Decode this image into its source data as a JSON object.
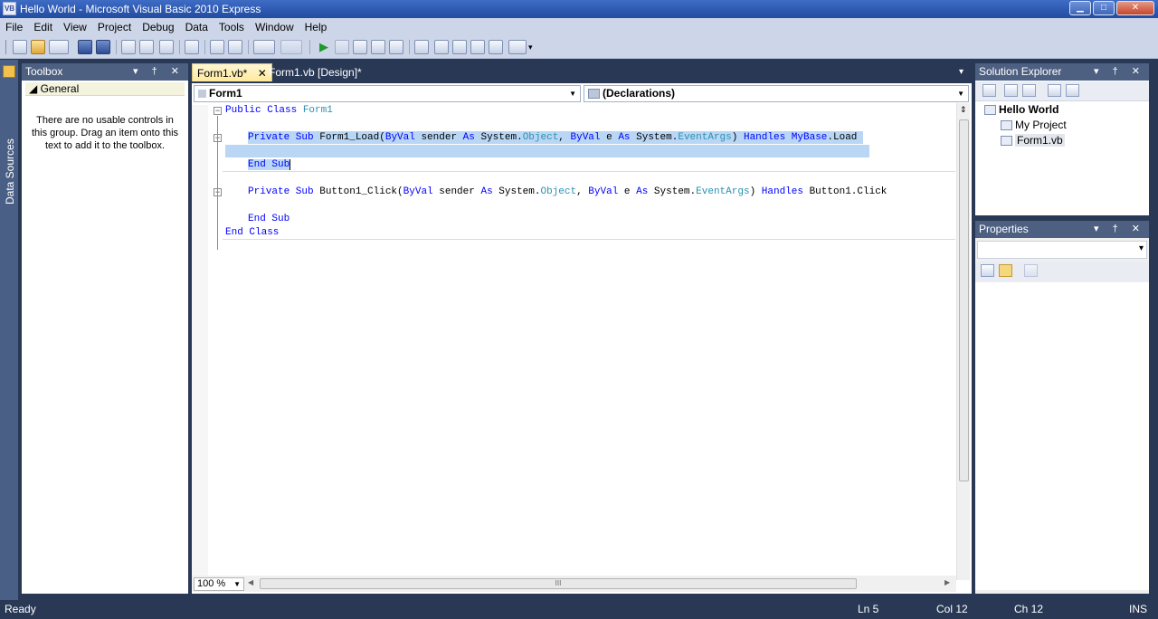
{
  "window": {
    "title": "Hello World - Microsoft Visual Basic 2010 Express",
    "icon_text": "VB",
    "controls": [
      "minimize-icon",
      "maximize-icon",
      "close-icon"
    ],
    "min_label": "▁",
    "max_label": "□",
    "close_label": "✕"
  },
  "menu": {
    "items": [
      "File",
      "Edit",
      "View",
      "Project",
      "Debug",
      "Data",
      "Tools",
      "Window",
      "Help"
    ]
  },
  "side_tab": {
    "label": "Data Sources"
  },
  "toolbox": {
    "title": "Toolbox",
    "buttons": "▾ † ✕",
    "group": "◢ General",
    "empty_text": "There are no usable controls in this group. Drag an item onto this text to add it to the toolbox."
  },
  "tabs": [
    {
      "label": "Form1.vb*",
      "close": "✕"
    },
    {
      "label": "Form1.vb [Design]*"
    }
  ],
  "tab_dropdown": "▾",
  "editor": {
    "class_combo": "Form1",
    "method_combo": "(Declarations)",
    "zoom": "100 %",
    "scroll_grip": "III"
  },
  "code": {
    "l1_kw": "Public Class ",
    "l1_ty": "Form1",
    "l2_kw1": "Private Sub ",
    "l2_name": "Form1_Load(",
    "l2_byval1": "ByVal",
    "l2_sender": " sender ",
    "l2_as1": "As",
    "l2_sys1": " System.",
    "l2_obj": "Object",
    "l2_comma": ", ",
    "l2_byval2": "ByVal",
    "l2_e": " e ",
    "l2_as2": "As",
    "l2_sys2": " System.",
    "l2_ev": "EventArgs",
    "l2_close": ") ",
    "l2_handles": "Handles",
    "l2_sp": " ",
    "l2_mybase": "MyBase",
    "l2_load": ".Load ",
    "l3_kw": "End Sub",
    "l4_kw1": "Private Sub ",
    "l4_name": "Button1_Click(",
    "l4_byval1": "ByVal",
    "l4_sender": " sender ",
    "l4_as1": "As",
    "l4_sys1": " System.",
    "l4_obj": "Object",
    "l4_comma": ", ",
    "l4_byval2": "ByVal",
    "l4_e": " e ",
    "l4_as2": "As",
    "l4_sys2": " System.",
    "l4_ev": "EventArgs",
    "l4_close": ") ",
    "l4_handles": "Handles",
    "l4_rest": " Button1.Click",
    "l5_kw": "End Sub",
    "l6_kw": "End Class"
  },
  "solution_explorer": {
    "title": "Solution Explorer",
    "buttons": "▾ † ✕",
    "items": [
      "Hello World",
      "My Project",
      "Form1.vb"
    ]
  },
  "properties": {
    "title": "Properties",
    "buttons": "▾ † ✕",
    "combo_arrow": "▾"
  },
  "status": {
    "text": "Ready",
    "ln": "Ln 5",
    "col": "Col 12",
    "ch": "Ch 12",
    "mode": "INS"
  },
  "colors": {
    "chrome": "#293955",
    "keyword": "#0000ff",
    "type": "#2b91af",
    "selection": "#b9d7f5"
  }
}
